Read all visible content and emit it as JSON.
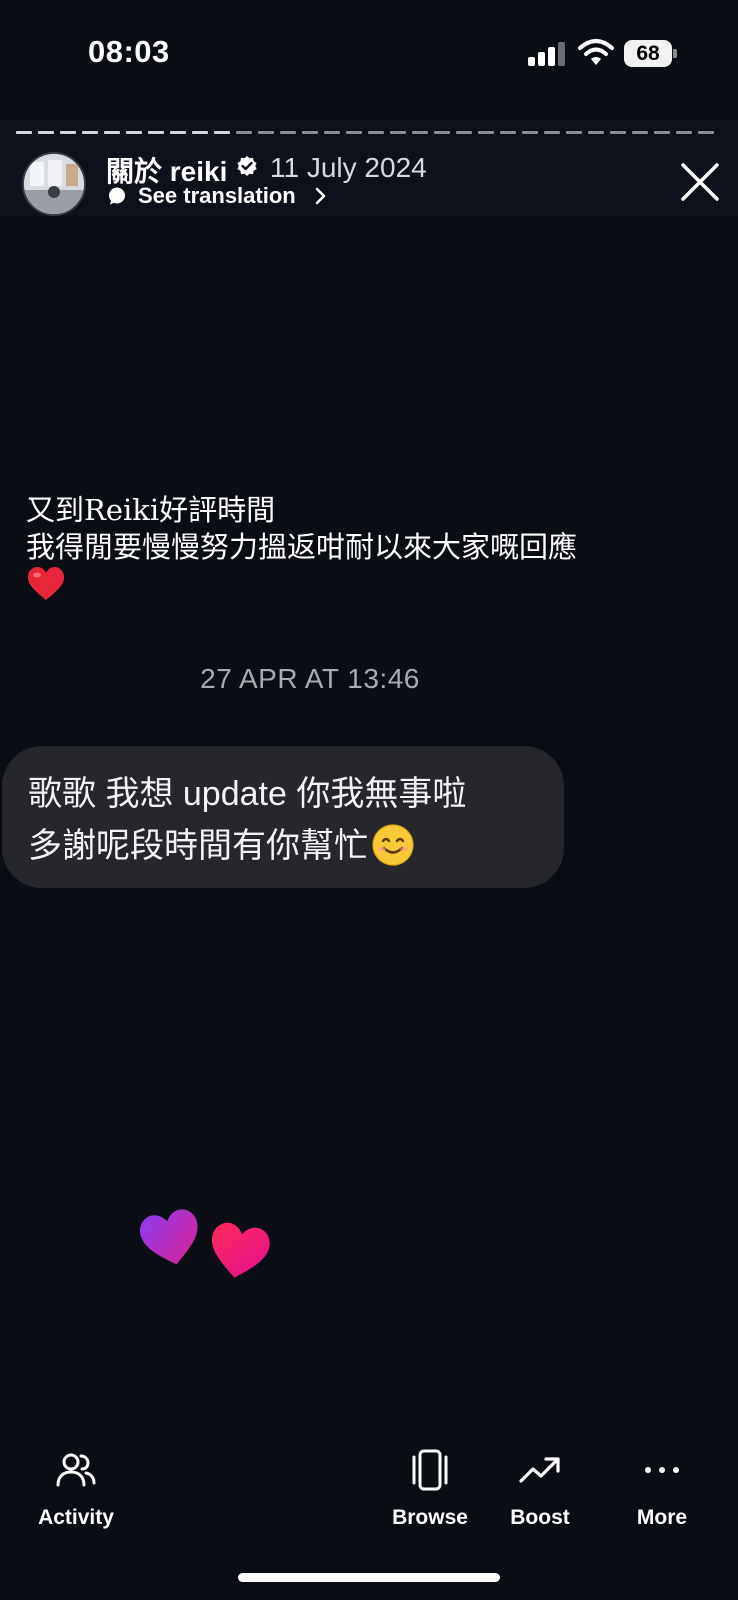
{
  "status_bar": {
    "time": "08:03",
    "battery": "68",
    "icons": [
      "cellular-signal-icon",
      "wifi-icon",
      "battery-icon"
    ]
  },
  "story_header": {
    "username": "關於 reiki",
    "date": "11 July 2024",
    "translate_label": "See translation",
    "icons": [
      "verified-badge-icon",
      "translate-icon",
      "chevron-right-icon",
      "close-icon"
    ]
  },
  "story": {
    "lines": [
      "又到Reiki好評時間",
      "我得閒要慢慢努力搵返咁耐以來大家嘅回應"
    ],
    "emoji": "red-heart-emoji"
  },
  "message": {
    "timestamp": "27 APR AT 13:46",
    "lines": [
      "歌歌 我想 update 你我無事啦",
      "多謝呢段時間有你幫忙"
    ],
    "emoji": "smiling-face-emoji"
  },
  "reactions": [
    "purple-heart-icon",
    "pink-heart-icon"
  ],
  "bottom_nav": {
    "items": [
      {
        "label": "Activity",
        "icon": "people-icon"
      },
      {
        "label": "Browse",
        "icon": "browse-cards-icon"
      },
      {
        "label": "Boost",
        "icon": "trending-up-icon"
      },
      {
        "label": "More",
        "icon": "more-dots-icon"
      }
    ]
  },
  "colors": {
    "background": "#0b0d14",
    "bubble": "#25272c",
    "heart_purple": "#a637e8",
    "heart_pink": "#f5147a"
  }
}
